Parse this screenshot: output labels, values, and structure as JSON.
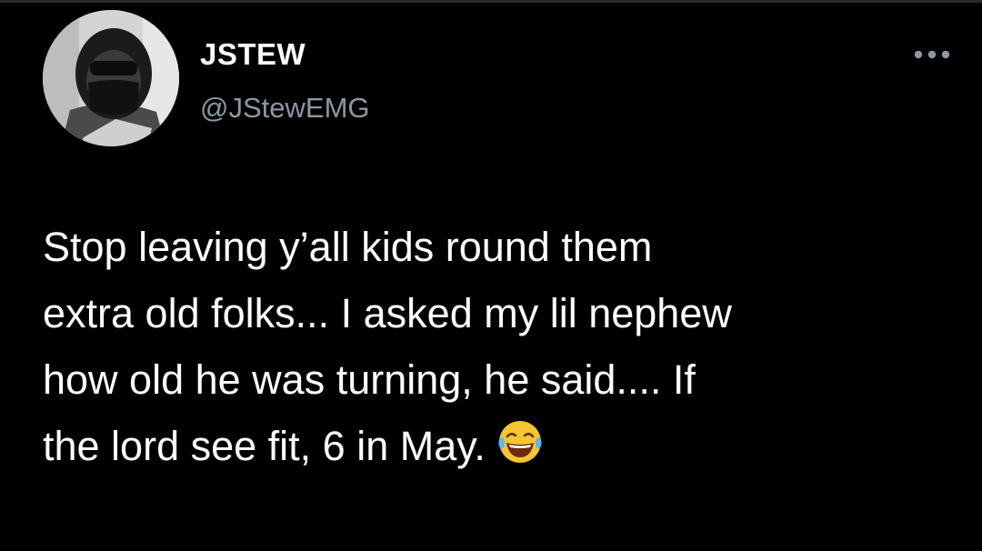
{
  "user": {
    "display_name": "JSTEW",
    "handle": "@JStewEMG",
    "avatar_icon": "profile-photo"
  },
  "menu": {
    "icon": "more-horizontal-icon"
  },
  "tweet": {
    "lines": [
      "Stop leaving y’all kids round them",
      "extra old folks... I asked my lil nephew",
      "how old he was turning, he said.... If",
      "the lord see fit, 6 in May."
    ],
    "emoji": "face-with-tears-of-joy-icon"
  },
  "colors": {
    "background": "#000000",
    "text": "#ffffff",
    "secondary_text": "#8b98a5"
  }
}
